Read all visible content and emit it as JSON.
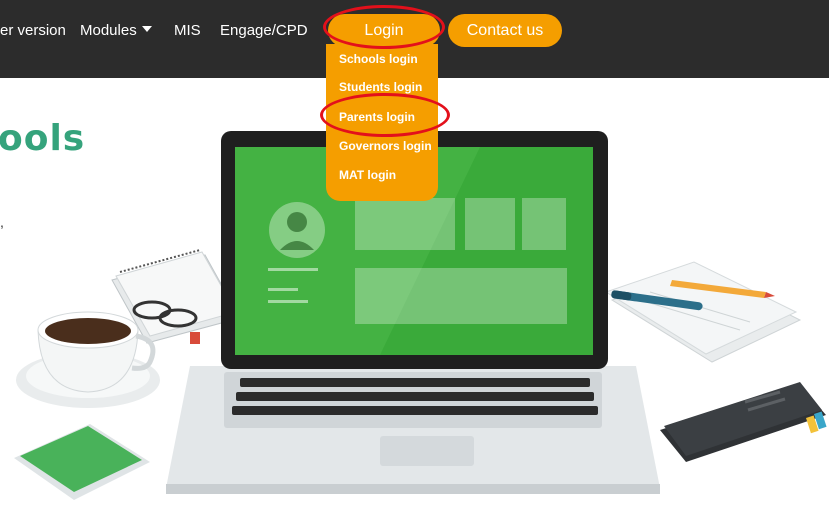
{
  "nav": {
    "items": [
      {
        "label": "er version"
      },
      {
        "label": "Modules"
      },
      {
        "label": "MIS"
      },
      {
        "label": "Engage/CPD"
      }
    ],
    "login_label": "Login",
    "contact_label": "Contact us"
  },
  "login_menu": {
    "items": [
      {
        "label": "Schools login"
      },
      {
        "label": "Students login"
      },
      {
        "label": "Parents login"
      },
      {
        "label": "Governors login"
      },
      {
        "label": "MAT login"
      }
    ]
  },
  "hero": {
    "title": "ools",
    "comma": ","
  },
  "colors": {
    "navbar": "#2c2c2c",
    "accent": "#f59e00",
    "highlight": "#e3101b",
    "title": "#35a37c",
    "screen": "#3aaa3a"
  }
}
